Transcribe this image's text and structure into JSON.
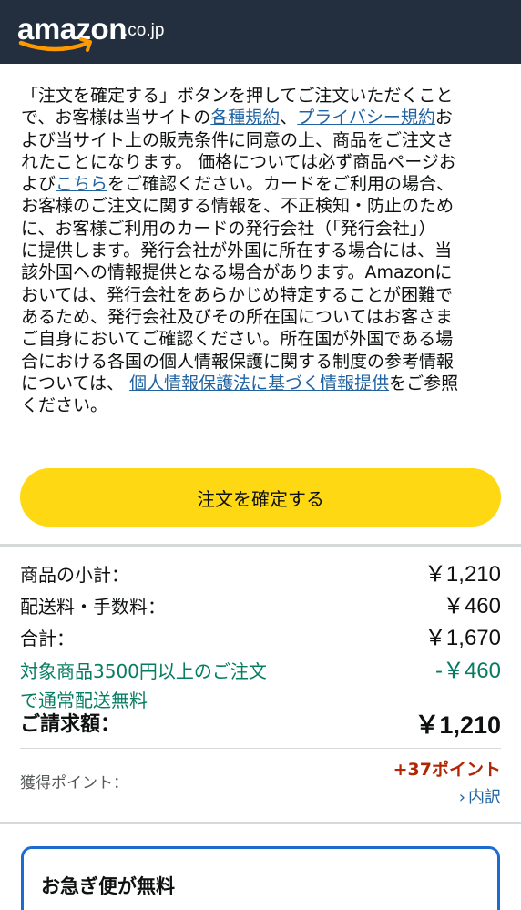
{
  "header": {
    "logo_word": "amazon",
    "logo_tld": ".co.jp",
    "logo_icon": "amazon-smile-arrow"
  },
  "terms": {
    "lines": [
      {
        "parts": [
          {
            "text": "「注文を確定する」ボタンを押してご注文いただくこと"
          }
        ]
      },
      {
        "parts": [
          {
            "text": "で、お客様は当サイトの"
          },
          {
            "text": "各種規約",
            "link": true
          },
          {
            "text": "、"
          },
          {
            "text": "プライバシー規約",
            "link": true
          },
          {
            "text": "お"
          }
        ]
      },
      {
        "parts": [
          {
            "text": "よび当サイト上の販売条件に同意の上、商品をご注文さ"
          }
        ]
      },
      {
        "parts": [
          {
            "text": "れたことになります。 価格については必ず商品ページお"
          }
        ]
      },
      {
        "parts": [
          {
            "text": "よび"
          },
          {
            "text": "こちら",
            "link": true
          },
          {
            "text": "をご確認ください。カードをご利用の場合、"
          }
        ]
      },
      {
        "parts": [
          {
            "text": "お客様のご注文に関する情報を、不正検知・防止のため"
          }
        ]
      },
      {
        "parts": [
          {
            "text": "に、お客様ご利用のカードの発行会社（「発行会社」）"
          }
        ]
      },
      {
        "parts": [
          {
            "text": "に提供します。発行会社が外国に所在する場合には、当"
          }
        ]
      },
      {
        "parts": [
          {
            "text": "該外国への情報提供となる場合があります。Amazonに"
          }
        ]
      },
      {
        "parts": [
          {
            "text": "おいては、発行会社をあらかじめ特定することが困難で"
          }
        ]
      },
      {
        "parts": [
          {
            "text": "あるため、発行会社及びその所在国についてはお客さま"
          }
        ]
      },
      {
        "parts": [
          {
            "text": "ご自身においてご確認ください。所在国が外国である場"
          }
        ]
      },
      {
        "parts": [
          {
            "text": "合における各国の個人情報保護に関する制度の参考情報"
          }
        ]
      },
      {
        "parts": [
          {
            "text": "については、 "
          },
          {
            "text": "個人情報保護法に基づく情報提供",
            "link": true
          },
          {
            "text": "をご参照"
          }
        ]
      },
      {
        "parts": [
          {
            "text": "ください。"
          }
        ]
      }
    ]
  },
  "place_order_label": "注文を確定する",
  "summary": {
    "subtotal_label": "商品の小計：",
    "subtotal_value": "￥1,210",
    "shipping_label": "配送料・手数料：",
    "shipping_value": "￥460",
    "total_label": "合計：",
    "total_value": "￥1,670",
    "promo_line1": "対象商品3500円以上のご注文",
    "promo_line2": "で通常配送無料",
    "promo_value": "-￥460",
    "order_total_label": "ご請求額：",
    "order_total_value": "￥1,210"
  },
  "points": {
    "label": "獲得ポイント：",
    "value": "+37ポイント",
    "breakdown_chevron": "›",
    "breakdown_label": "内訳"
  },
  "free_express": {
    "title": "お急ぎ便が無料"
  },
  "colors": {
    "header_bg": "#232f3e",
    "logo_smile": "#ff9900",
    "button_yellow": "#ffd814",
    "link_blue": "#2162a1",
    "promo_green": "#067d62",
    "points_red": "#b12704",
    "card_border": "#1c6bd3"
  }
}
